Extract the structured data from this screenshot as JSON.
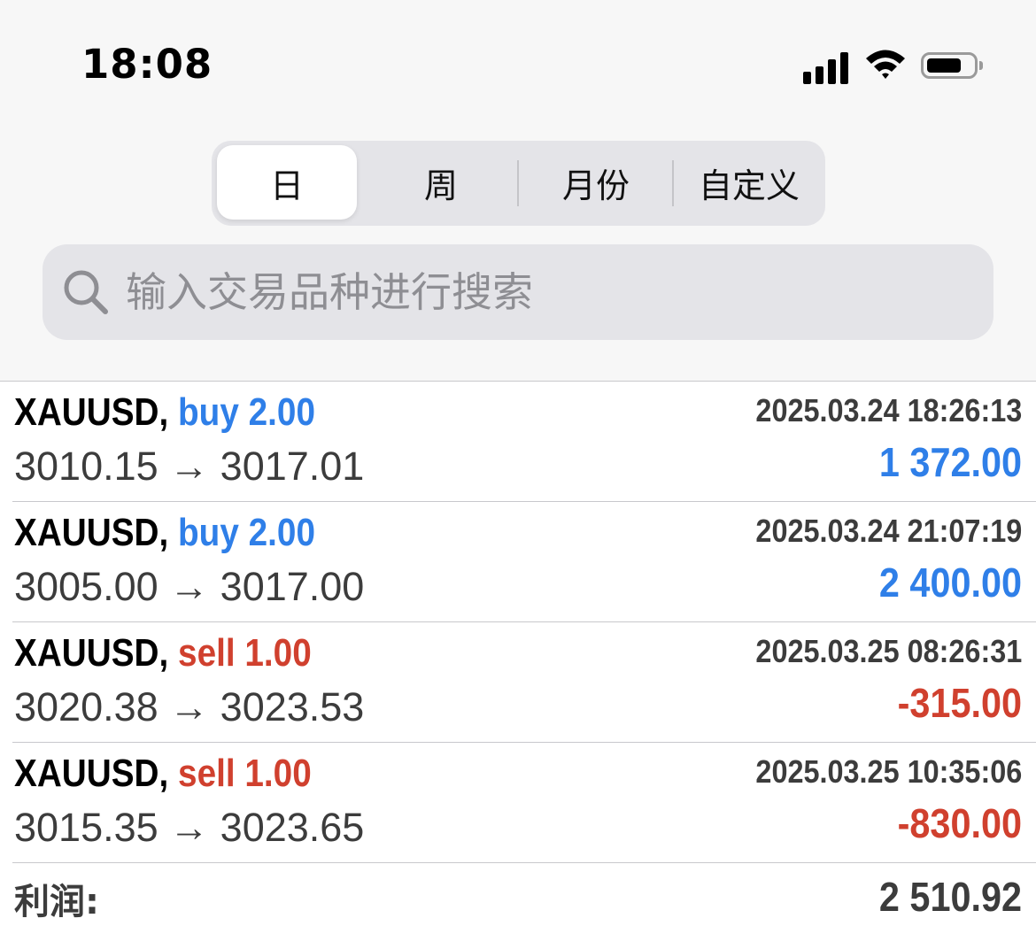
{
  "status_bar": {
    "time": "18:08",
    "icons": [
      "cellular-signal-icon",
      "wifi-icon",
      "battery-icon"
    ]
  },
  "period_selector": {
    "selected": "日",
    "tabs": [
      {
        "label": "日"
      },
      {
        "label": "周"
      },
      {
        "label": "月份"
      },
      {
        "label": "自定义"
      }
    ]
  },
  "search": {
    "placeholder": "输入交易品种进行搜索",
    "value": ""
  },
  "deals": [
    {
      "symbol": "XAUUSD,",
      "type": "buy 2.00",
      "direction": "buy",
      "time": "2025.03.24 18:26:13",
      "prices": "3010.15 → 3017.01",
      "profit": "1 372.00"
    },
    {
      "symbol": "XAUUSD,",
      "type": "buy 2.00",
      "direction": "buy",
      "time": "2025.03.24 21:07:19",
      "prices": "3005.00 → 3017.00",
      "profit": "2 400.00"
    },
    {
      "symbol": "XAUUSD,",
      "type": "sell 1.00",
      "direction": "sell",
      "time": "2025.03.25 08:26:31",
      "prices": "3020.38 → 3023.53",
      "profit": "-315.00"
    },
    {
      "symbol": "XAUUSD,",
      "type": "sell 1.00",
      "direction": "sell",
      "time": "2025.03.25 10:35:06",
      "prices": "3015.35 → 3023.65",
      "profit": "-830.00"
    }
  ],
  "summary": {
    "label": "利润:",
    "value": "2 510.92"
  },
  "colors": {
    "buy": "#2f7fe8",
    "sell": "#d0402e",
    "text": "#3c3c3c",
    "background_top": "#f7f7f7",
    "control_fill": "#e4e4e8"
  }
}
